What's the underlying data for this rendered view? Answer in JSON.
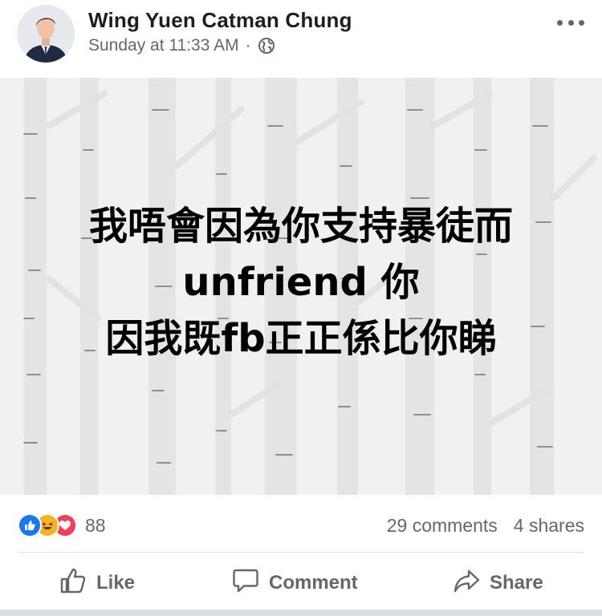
{
  "post": {
    "author": "Wing Yuen Catman Chung",
    "timestamp": "Sunday at 11:33 AM",
    "separator": "·",
    "privacy_icon": "globe-icon",
    "more_icon": "more-options-icon",
    "text_lines": [
      "我唔會因為你支持暴徒而",
      "unfriend 你",
      "因我既fb正正係比你睇"
    ],
    "background": "birch-forest-pattern"
  },
  "stats": {
    "reactions": [
      "like",
      "haha",
      "love"
    ],
    "reaction_count": "88",
    "comments": "29 comments",
    "shares": "4 shares"
  },
  "actions": {
    "like": "Like",
    "comment": "Comment",
    "share": "Share"
  },
  "colors": {
    "like_blue": "#1877f2",
    "haha_yellow": "#f7b125",
    "love_red": "#f33e58",
    "meta_gray": "#65676b"
  }
}
